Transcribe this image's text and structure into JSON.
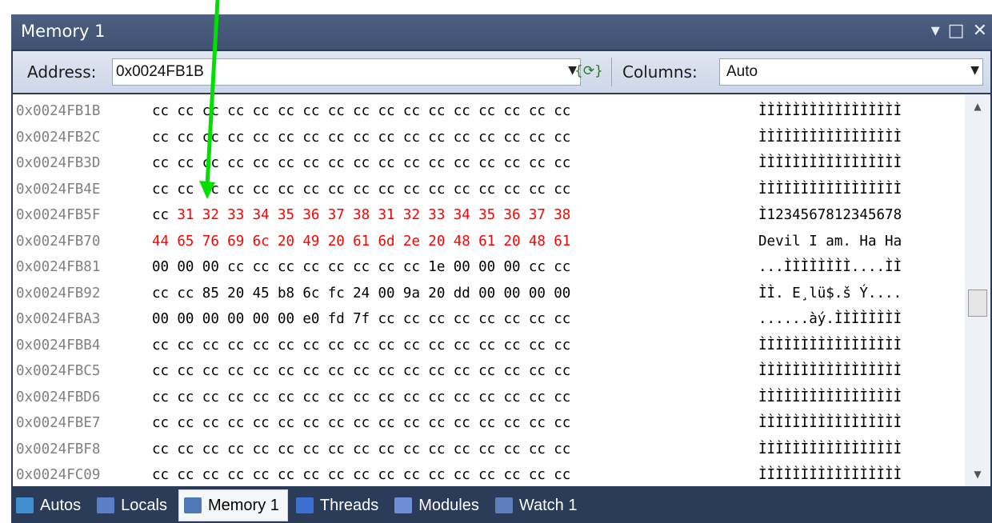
{
  "window": {
    "title": "Memory 1"
  },
  "toolbar": {
    "address_label": "Address:",
    "address_value": "0x0024FB1B",
    "columns_label": "Columns:",
    "columns_value": "Auto"
  },
  "rows": [
    {
      "address": "0x0024FB1B",
      "bytes": [
        "cc",
        "cc",
        "cc",
        "cc",
        "cc",
        "cc",
        "cc",
        "cc",
        "cc",
        "cc",
        "cc",
        "cc",
        "cc",
        "cc",
        "cc",
        "cc",
        "cc"
      ],
      "ascii": "ÌÌÌÌÌÌÌÌÌÌÌÌÌÌÌÌÌ",
      "changed_from": 99
    },
    {
      "address": "0x0024FB2C",
      "bytes": [
        "cc",
        "cc",
        "cc",
        "cc",
        "cc",
        "cc",
        "cc",
        "cc",
        "cc",
        "cc",
        "cc",
        "cc",
        "cc",
        "cc",
        "cc",
        "cc",
        "cc"
      ],
      "ascii": "ÌÌÌÌÌÌÌÌÌÌÌÌÌÌÌÌÌ",
      "changed_from": 99
    },
    {
      "address": "0x0024FB3D",
      "bytes": [
        "cc",
        "cc",
        "cc",
        "cc",
        "cc",
        "cc",
        "cc",
        "cc",
        "cc",
        "cc",
        "cc",
        "cc",
        "cc",
        "cc",
        "cc",
        "cc",
        "cc"
      ],
      "ascii": "ÌÌÌÌÌÌÌÌÌÌÌÌÌÌÌÌÌ",
      "changed_from": 99
    },
    {
      "address": "0x0024FB4E",
      "bytes": [
        "cc",
        "cc",
        "cc",
        "cc",
        "cc",
        "cc",
        "cc",
        "cc",
        "cc",
        "cc",
        "cc",
        "cc",
        "cc",
        "cc",
        "cc",
        "cc",
        "cc"
      ],
      "ascii": "ÌÌÌÌÌÌÌÌÌÌÌÌÌÌÌÌÌ",
      "changed_from": 99
    },
    {
      "address": "0x0024FB5F",
      "bytes": [
        "cc",
        "31",
        "32",
        "33",
        "34",
        "35",
        "36",
        "37",
        "38",
        "31",
        "32",
        "33",
        "34",
        "35",
        "36",
        "37",
        "38"
      ],
      "ascii": "Ì1234567812345678",
      "changed_from": 1
    },
    {
      "address": "0x0024FB70",
      "bytes": [
        "44",
        "65",
        "76",
        "69",
        "6c",
        "20",
        "49",
        "20",
        "61",
        "6d",
        "2e",
        "20",
        "48",
        "61",
        "20",
        "48",
        "61"
      ],
      "ascii": "Devil I am. Ha Ha",
      "changed_from": 0
    },
    {
      "address": "0x0024FB81",
      "bytes": [
        "00",
        "00",
        "00",
        "cc",
        "cc",
        "cc",
        "cc",
        "cc",
        "cc",
        "cc",
        "cc",
        "1e",
        "00",
        "00",
        "00",
        "cc",
        "cc"
      ],
      "ascii": "...ÌÌÌÌÌÌÌÌ....ÌÌ",
      "changed_from": 99
    },
    {
      "address": "0x0024FB92",
      "bytes": [
        "cc",
        "cc",
        "85",
        "20",
        "45",
        "b8",
        "6c",
        "fc",
        "24",
        "00",
        "9a",
        "20",
        "dd",
        "00",
        "00",
        "00",
        "00"
      ],
      "ascii": "ÌÌ. E¸lü$.š Ý....",
      "changed_from": 99
    },
    {
      "address": "0x0024FBA3",
      "bytes": [
        "00",
        "00",
        "00",
        "00",
        "00",
        "00",
        "e0",
        "fd",
        "7f",
        "cc",
        "cc",
        "cc",
        "cc",
        "cc",
        "cc",
        "cc",
        "cc"
      ],
      "ascii": "......àý.ÌÌÌÌÌÌÌÌ",
      "changed_from": 99
    },
    {
      "address": "0x0024FBB4",
      "bytes": [
        "cc",
        "cc",
        "cc",
        "cc",
        "cc",
        "cc",
        "cc",
        "cc",
        "cc",
        "cc",
        "cc",
        "cc",
        "cc",
        "cc",
        "cc",
        "cc",
        "cc"
      ],
      "ascii": "ÌÌÌÌÌÌÌÌÌÌÌÌÌÌÌÌÌ",
      "changed_from": 99
    },
    {
      "address": "0x0024FBC5",
      "bytes": [
        "cc",
        "cc",
        "cc",
        "cc",
        "cc",
        "cc",
        "cc",
        "cc",
        "cc",
        "cc",
        "cc",
        "cc",
        "cc",
        "cc",
        "cc",
        "cc",
        "cc"
      ],
      "ascii": "ÌÌÌÌÌÌÌÌÌÌÌÌÌÌÌÌÌ",
      "changed_from": 99
    },
    {
      "address": "0x0024FBD6",
      "bytes": [
        "cc",
        "cc",
        "cc",
        "cc",
        "cc",
        "cc",
        "cc",
        "cc",
        "cc",
        "cc",
        "cc",
        "cc",
        "cc",
        "cc",
        "cc",
        "cc",
        "cc"
      ],
      "ascii": "ÌÌÌÌÌÌÌÌÌÌÌÌÌÌÌÌÌ",
      "changed_from": 99
    },
    {
      "address": "0x0024FBE7",
      "bytes": [
        "cc",
        "cc",
        "cc",
        "cc",
        "cc",
        "cc",
        "cc",
        "cc",
        "cc",
        "cc",
        "cc",
        "cc",
        "cc",
        "cc",
        "cc",
        "cc",
        "cc"
      ],
      "ascii": "ÌÌÌÌÌÌÌÌÌÌÌÌÌÌÌÌÌ",
      "changed_from": 99
    },
    {
      "address": "0x0024FBF8",
      "bytes": [
        "cc",
        "cc",
        "cc",
        "cc",
        "cc",
        "cc",
        "cc",
        "cc",
        "cc",
        "cc",
        "cc",
        "cc",
        "cc",
        "cc",
        "cc",
        "cc",
        "cc"
      ],
      "ascii": "ÌÌÌÌÌÌÌÌÌÌÌÌÌÌÌÌÌ",
      "changed_from": 99
    },
    {
      "address": "0x0024FC09",
      "bytes": [
        "cc",
        "cc",
        "cc",
        "cc",
        "cc",
        "cc",
        "cc",
        "cc",
        "cc",
        "cc",
        "cc",
        "cc",
        "cc",
        "cc",
        "cc",
        "cc",
        "cc"
      ],
      "ascii": "ÌÌÌÌÌÌÌÌÌÌÌÌÌÌÌÌÌ",
      "changed_from": 99
    }
  ],
  "tabs": [
    {
      "label": "Autos",
      "icon": "autos-icon",
      "active": false,
      "color": "#3f8fd0"
    },
    {
      "label": "Locals",
      "icon": "locals-icon",
      "active": false,
      "color": "#5a7ec8"
    },
    {
      "label": "Memory 1",
      "icon": "memory-icon",
      "active": true,
      "color": "#4f78b8"
    },
    {
      "label": "Threads",
      "icon": "threads-icon",
      "active": false,
      "color": "#3c6fd1"
    },
    {
      "label": "Modules",
      "icon": "modules-icon",
      "active": false,
      "color": "#6d8fd8"
    },
    {
      "label": "Watch 1",
      "icon": "watch-icon",
      "active": false,
      "color": "#5b7fbd"
    }
  ],
  "colors": {
    "changed": "#ff0000",
    "address_text": "#808080",
    "annotation_arrow": "#00e000"
  }
}
